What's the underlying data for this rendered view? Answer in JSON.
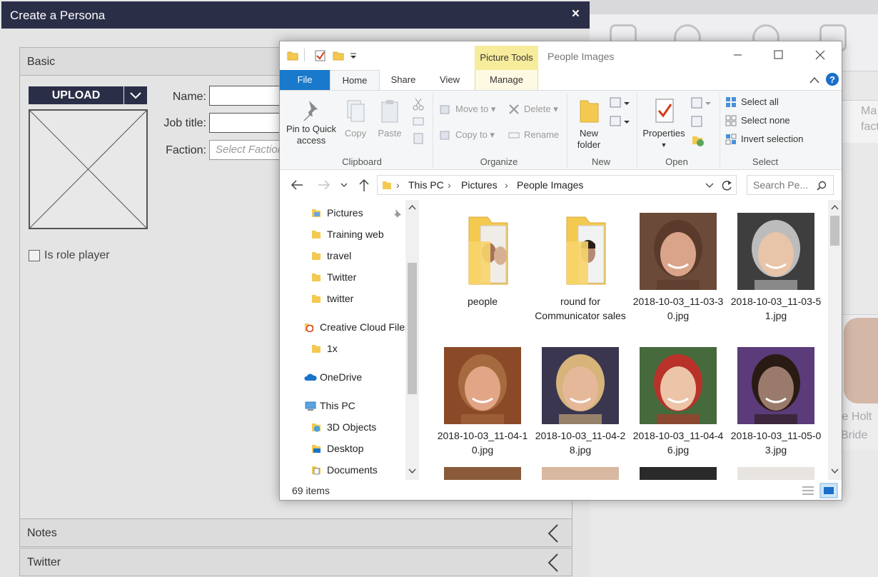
{
  "persona": {
    "title": "Create a Persona",
    "close_glyph": "×",
    "sections": {
      "basic": "Basic",
      "notes": "Notes",
      "twitter": "Twitter"
    },
    "upload_label": "UPLOAD",
    "name_label": "Name:",
    "job_label": "Job title:",
    "faction_label": "Faction:",
    "faction_placeholder": "Select Faction",
    "role_player_label": "Is role player"
  },
  "background": {
    "texts": [
      "Ma",
      "fact",
      "ie Holt",
      "Bride"
    ]
  },
  "explorer": {
    "context_tab": "Picture Tools",
    "title": "People Images",
    "tabs": {
      "file": "File",
      "home": "Home",
      "share": "Share",
      "view": "View",
      "manage": "Manage"
    },
    "ribbon": {
      "pin": "Pin to Quick access",
      "copy": "Copy",
      "paste": "Paste",
      "clipboard": "Clipboard",
      "move_to": "Move to",
      "copy_to": "Copy to",
      "delete": "Delete",
      "rename": "Rename",
      "organize": "Organize",
      "new_folder": "New folder",
      "new": "New",
      "properties": "Properties",
      "open": "Open",
      "select_all": "Select all",
      "select_none": "Select none",
      "invert_selection": "Invert selection",
      "select": "Select"
    },
    "address": {
      "crumbs": [
        "This PC",
        "Pictures",
        "People Images"
      ]
    },
    "search_placeholder": "Search Pe...",
    "nav": [
      {
        "label": "Pictures",
        "type": "folder"
      },
      {
        "label": "Training web",
        "type": "folder"
      },
      {
        "label": "travel",
        "type": "folder"
      },
      {
        "label": "Twitter",
        "type": "folder"
      },
      {
        "label": "twitter",
        "type": "folder"
      },
      {
        "label": "Creative Cloud Files",
        "type": "cc"
      },
      {
        "label": "1x",
        "type": "folder"
      },
      {
        "label": "OneDrive",
        "type": "onedrive"
      },
      {
        "label": "This PC",
        "type": "pc"
      },
      {
        "label": "3D Objects",
        "type": "3d"
      },
      {
        "label": "Desktop",
        "type": "desktop"
      },
      {
        "label": "Documents",
        "type": "docs"
      }
    ],
    "files": [
      {
        "name": "people",
        "kind": "folder"
      },
      {
        "name": "round for Communicator sales",
        "kind": "folder"
      },
      {
        "name": "2018-10-03_11-03-30.jpg",
        "kind": "photo",
        "bg": "#6b4a3a",
        "face": "#d9a48a",
        "hair": "#5a3b2b"
      },
      {
        "name": "2018-10-03_11-03-51.jpg",
        "kind": "photo",
        "bg": "#3e3e3e",
        "face": "#e8c4a8",
        "hair": "#bcbcbc"
      },
      {
        "name": "2018-10-03_11-04-10.jpg",
        "kind": "photo",
        "bg": "#8a4a28",
        "face": "#e2a586",
        "hair": "#a66a3f"
      },
      {
        "name": "2018-10-03_11-04-28.jpg",
        "kind": "photo",
        "bg": "#3a3650",
        "face": "#e6b89a",
        "hair": "#d6b47a"
      },
      {
        "name": "2018-10-03_11-04-46.jpg",
        "kind": "photo",
        "bg": "#466a3c",
        "face": "#ecc4a8",
        "hair": "#b8322a"
      },
      {
        "name": "2018-10-03_11-05-03.jpg",
        "kind": "photo",
        "bg": "#5b3b7a",
        "face": "#9a7a6a",
        "hair": "#2a1a14"
      }
    ],
    "status_count": "69 items"
  }
}
